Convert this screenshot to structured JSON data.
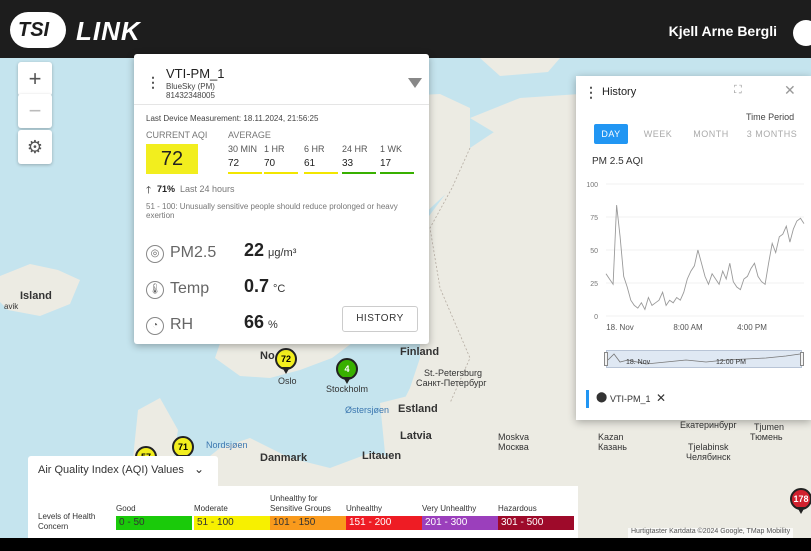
{
  "header": {
    "logo_badge": "TSI",
    "logo_text": "LINK",
    "user_name": "Kjell Arne Bergli"
  },
  "map_controls": {
    "zoom_in": "+",
    "zoom_out": "−",
    "settings": "⚙"
  },
  "map_labels": {
    "island": "Island",
    "finland": "Finland",
    "st_petersburg": "St.-Petersburg",
    "st_petersburg_ru": "Санкт-Петербург",
    "stockholm": "Stockholm",
    "oslo": "Oslo",
    "no": "No",
    "ostersjoen": "Østersjøen",
    "estland": "Estland",
    "latvia": "Latvia",
    "litauen": "Litauen",
    "danmark": "Danmark",
    "nordsjoen": "Nordsjøen",
    "moskva": "Moskva",
    "moskva_ru": "Москва",
    "kazan": "Kazan",
    "kazan_ru": "Казань",
    "tjelabinsk": "Tjelabinsk",
    "tjelabinsk_ru": "Челябинск",
    "tjumen": "Tjumen",
    "tjumen_ru": "Тюмень",
    "jekaterinburg_ru": "Екатеринбург",
    "avik": "avik"
  },
  "pins": {
    "oslo": "72",
    "stockholm": "4",
    "nordsjoen": "71",
    "nordsjoen_small": "57",
    "east": "178"
  },
  "device": {
    "name": "VTI-PM_1",
    "model": "BlueSky (PM)",
    "serial": "81432348005",
    "last_measurement": "Last Device Measurement: 18.11.2024, 21:56:25",
    "current_label": "CURRENT AQI",
    "current_value": "72",
    "average_label": "AVERAGE",
    "averages": [
      {
        "label": "30 MIN",
        "value": "72",
        "color": "#f2e600"
      },
      {
        "label": "1 HR",
        "value": "70",
        "color": "#f2e600"
      },
      {
        "label": "6 HR",
        "value": "61",
        "color": "#f2e600"
      },
      {
        "label": "24 HR",
        "value": "33",
        "color": "#38b000"
      },
      {
        "label": "1 WK",
        "value": "17",
        "color": "#38b000"
      }
    ],
    "trend_pct": "71%",
    "trend_text": "Last 24 hours",
    "advisory": "51 - 100: Unusually sensitive people should reduce prolonged or heavy exertion",
    "measurements": [
      {
        "name": "PM2.5",
        "value": "22",
        "unit": "μg/m³",
        "icon": "pm-icon"
      },
      {
        "name": "Temp",
        "value": "0.7",
        "unit": "°C",
        "icon": "thermometer-icon"
      },
      {
        "name": "RH",
        "value": "66",
        "unit": "%",
        "icon": "humidity-icon"
      }
    ],
    "history_button": "HISTORY",
    "colors": {
      "current": "#f2ee1e"
    }
  },
  "history": {
    "title": "History",
    "time_period_label": "Time Period",
    "tabs": [
      "DAY",
      "WEEK",
      "MONTH",
      "3 MONTHS"
    ],
    "active_tab": "DAY",
    "chart_title": "PM 2.5 AQI",
    "nav_labels": [
      "18. Nov",
      "12:00 PM"
    ],
    "legend_item": "VTI-PM_1",
    "accent": "#2196f3"
  },
  "chart_data": {
    "type": "line",
    "title": "PM 2.5 AQI",
    "xlabel": "",
    "ylabel": "",
    "x_ticks": [
      "18. Nov",
      "8:00 AM",
      "4:00 PM"
    ],
    "y_ticks": [
      0,
      25,
      50,
      75,
      100
    ],
    "ylim": [
      0,
      100
    ],
    "series": [
      {
        "values": [
          32,
          28,
          24,
          84,
          60,
          30,
          22,
          12,
          8,
          6,
          10,
          5,
          14,
          8,
          10,
          12,
          18,
          8,
          12,
          10,
          14,
          12,
          18,
          28,
          34,
          38,
          50,
          40,
          30,
          24,
          32,
          28,
          24,
          34,
          28,
          40,
          26,
          22,
          20,
          28,
          30,
          36,
          40,
          30,
          26,
          24,
          40,
          55,
          48,
          60,
          62,
          68,
          56,
          66,
          72,
          74,
          70
        ]
      }
    ]
  },
  "legend": {
    "title": "Air Quality Index (AQI) Values",
    "row_label": "Levels of Health Concern",
    "levels": [
      {
        "name": "Good",
        "range": "0 - 50",
        "color": "#1aca0a",
        "text": "#333"
      },
      {
        "name": "Moderate",
        "range": "51 - 100",
        "color": "#f7f000",
        "text": "#333"
      },
      {
        "name": "Unhealthy for Sensitive Groups",
        "range": "101 - 150",
        "color": "#f99a1c",
        "text": "#333"
      },
      {
        "name": "Unhealthy",
        "range": "151 - 200",
        "color": "#ee1c24",
        "text": "#fff"
      },
      {
        "name": "Very Unhealthy",
        "range": "201 - 300",
        "color": "#9b3fbc",
        "text": "#fff"
      },
      {
        "name": "Hazardous",
        "range": "301 - 500",
        "color": "#9e0a2a",
        "text": "#fff"
      }
    ]
  },
  "attribution": "Hurtigtaster   Kartdata ©2024 Google, TMap Mobility"
}
